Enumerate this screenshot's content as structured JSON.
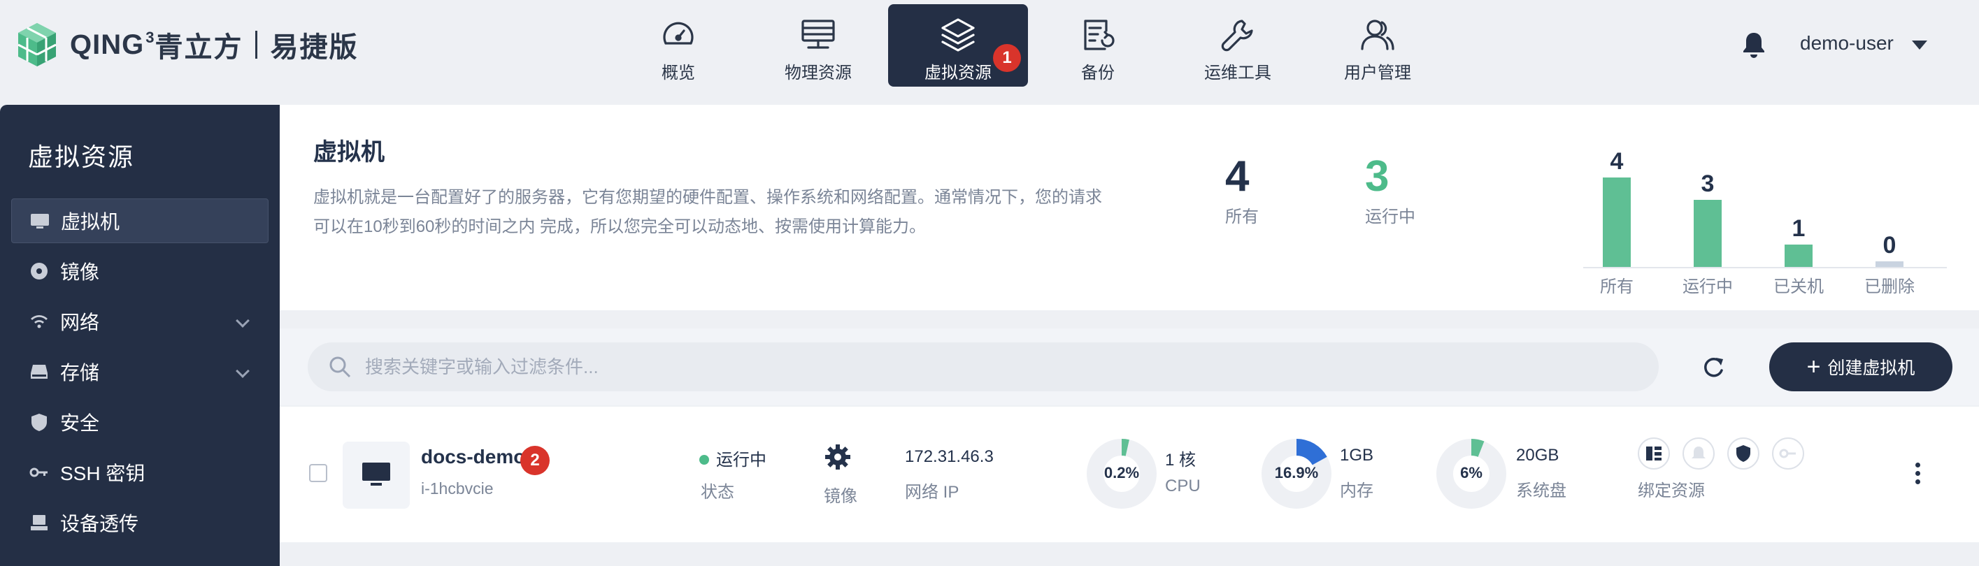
{
  "brand": {
    "name": "QING",
    "superscript": "3",
    "cn_name": "青立方",
    "edition": "易捷版"
  },
  "nav": {
    "items": [
      {
        "label": "概览",
        "icon": "gauge-icon"
      },
      {
        "label": "物理资源",
        "icon": "server-icon"
      },
      {
        "label": "虚拟资源",
        "icon": "layers-icon",
        "active": true,
        "badge": "1"
      },
      {
        "label": "备份",
        "icon": "backup-icon"
      },
      {
        "label": "运维工具",
        "icon": "wrench-icon"
      },
      {
        "label": "用户管理",
        "icon": "users-icon"
      }
    ],
    "user": "demo-user"
  },
  "sidebar": {
    "title": "虚拟资源",
    "items": [
      {
        "label": "虚拟机",
        "icon": "monitor-icon",
        "active": true
      },
      {
        "label": "镜像",
        "icon": "disc-icon"
      },
      {
        "label": "网络",
        "icon": "wifi-icon",
        "expandable": true
      },
      {
        "label": "存储",
        "icon": "drive-icon",
        "expandable": true
      },
      {
        "label": "安全",
        "icon": "shield-icon"
      },
      {
        "label": "SSH 密钥",
        "icon": "key-icon"
      },
      {
        "label": "设备透传",
        "icon": "device-icon"
      }
    ]
  },
  "summary": {
    "title": "虚拟机",
    "description": "虚拟机就是一台配置好了的服务器，它有您期望的硬件配置、操作系统和网络配置。通常情况下，您的请求可以在10秒到60秒的时间之内 完成，所以您完全可以动态地、按需使用计算能力。",
    "stats": [
      {
        "value": "4",
        "label": "所有"
      },
      {
        "value": "3",
        "label": "运行中"
      }
    ]
  },
  "chart_data": {
    "type": "bar",
    "categories": [
      "所有",
      "运行中",
      "已关机",
      "已删除"
    ],
    "values": [
      4,
      3,
      1,
      0
    ],
    "colors": [
      "#5fbf94",
      "#5fbf94",
      "#5fbf94",
      "#c9d3e0"
    ]
  },
  "toolbar": {
    "search_placeholder": "搜索关键字或输入过滤条件...",
    "create_label": "创建虚拟机"
  },
  "vm": {
    "name": "docs-demo",
    "badge": "2",
    "id": "i-1hcbvcie",
    "status_value": "运行中",
    "status_label": "状态",
    "image_label": "镜像",
    "ip_value": "172.31.46.3",
    "ip_label": "网络 IP",
    "cpu": {
      "percent_text": "0.2%",
      "percent": 0.2,
      "value": "1 核",
      "label": "CPU"
    },
    "memory": {
      "percent_text": "16.9%",
      "percent": 16.9,
      "value": "1GB",
      "label": "内存"
    },
    "disk": {
      "percent_text": "6%",
      "percent": 6,
      "value": "20GB",
      "label": "系统盘"
    },
    "bound_label": "绑定资源",
    "colors": {
      "running": "#4dbb8a",
      "cpu": "#5fbf94",
      "memory": "#2f6fd6",
      "disk": "#5fbf94",
      "track": "#eef0f4"
    }
  }
}
